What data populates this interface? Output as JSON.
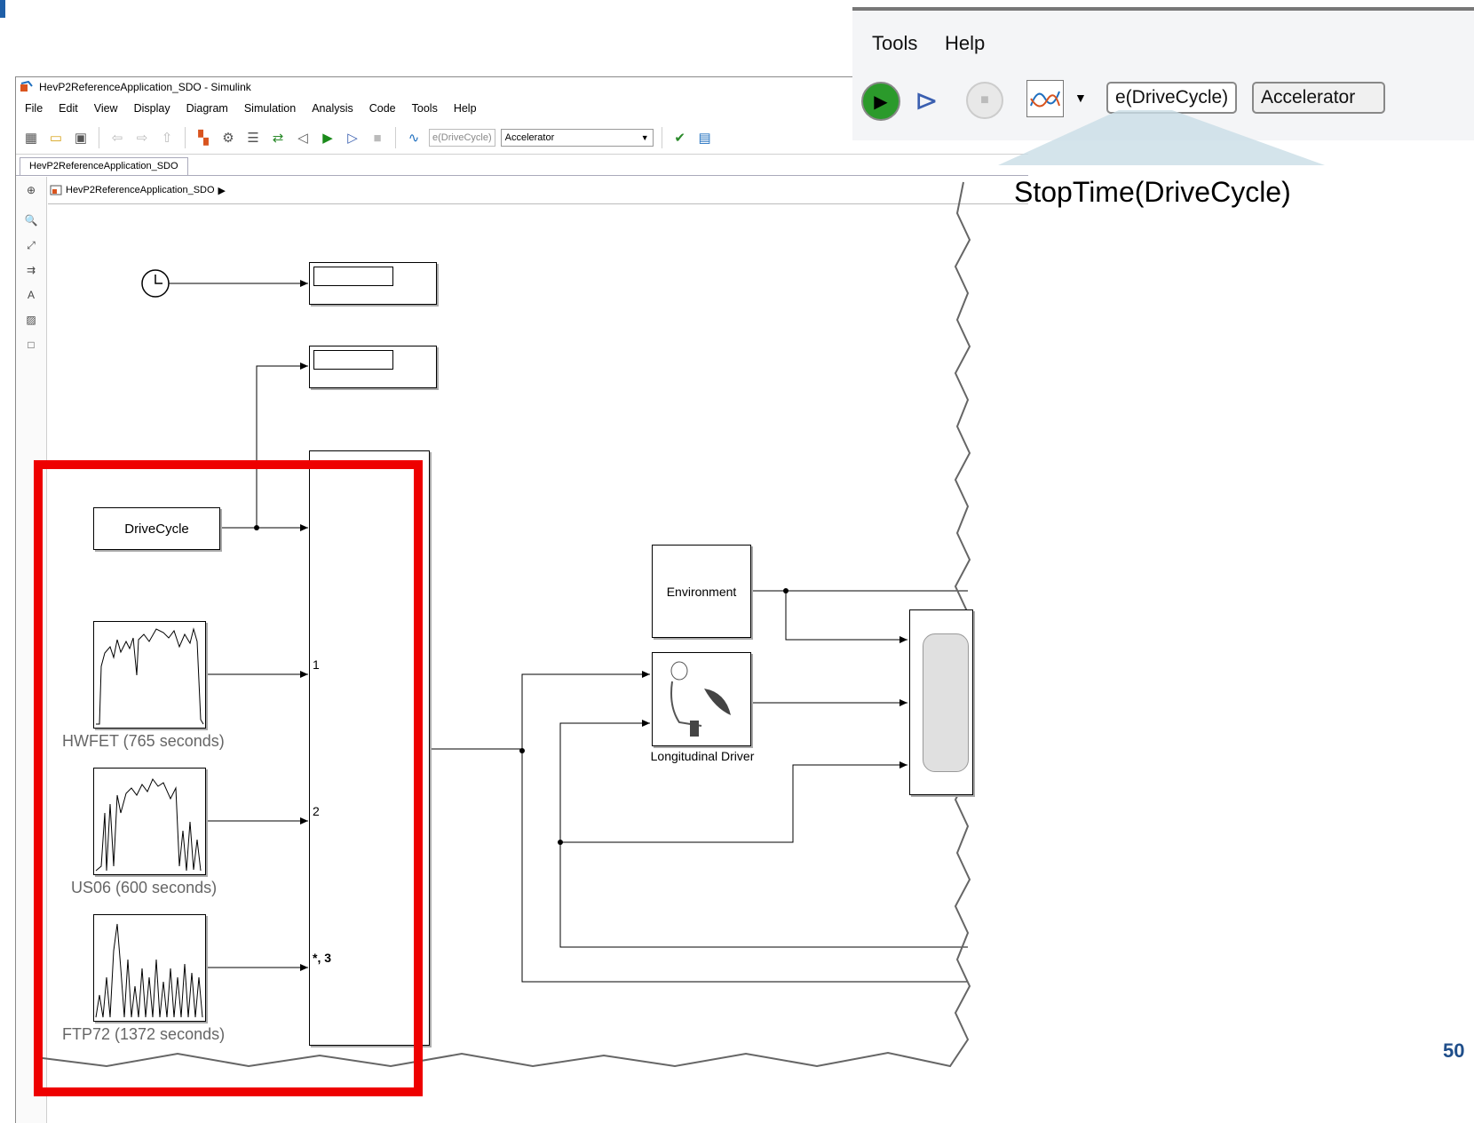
{
  "window": {
    "title": "HevP2ReferenceApplication_SDO - Simulink",
    "menu": [
      "File",
      "Edit",
      "View",
      "Display",
      "Diagram",
      "Simulation",
      "Analysis",
      "Code",
      "Tools",
      "Help"
    ],
    "stop_time_field": "e(DriveCycle)",
    "signal_select": "Accelerator",
    "tab_label": "HevP2ReferenceApplication_SDO",
    "breadcrumb": "HevP2ReferenceApplication_SDO"
  },
  "diagram": {
    "drivecycle_block": "DriveCycle",
    "environment_block": "Environment",
    "driver_block": "Longitudinal Driver",
    "sources": [
      {
        "label": "HWFET (765  seconds)",
        "port": "1"
      },
      {
        "label": "US06 (600  seconds)",
        "port": "2"
      },
      {
        "label": "FTP72 (1372  seconds)",
        "port": "*, 3"
      }
    ]
  },
  "callout": {
    "menu": [
      "Tools",
      "Help"
    ],
    "stop_time_field": "e(DriveCycle)",
    "signal_select": "Accelerator",
    "caption": "StopTime(DriveCycle)"
  },
  "page_number": "50"
}
